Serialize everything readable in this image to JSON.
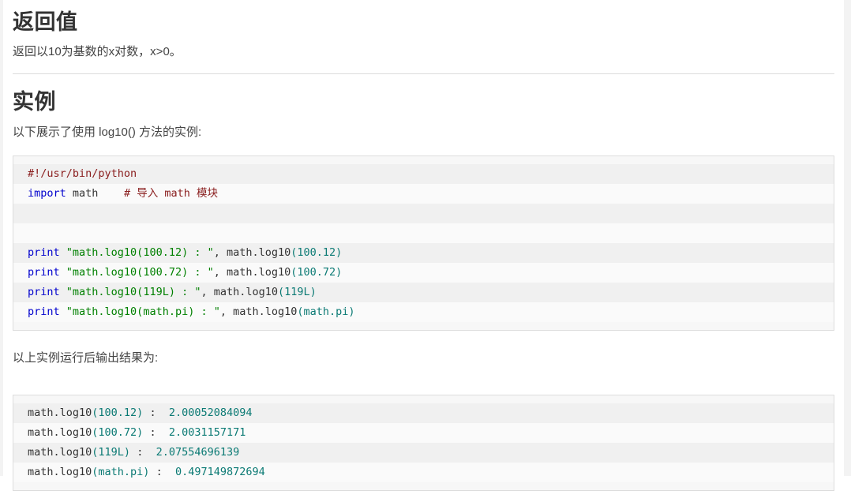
{
  "page": {
    "background_color": "#ffffff",
    "text_color": "#333333",
    "divider_color": "#dddddd"
  },
  "sections": {
    "return_value": {
      "heading": "返回值",
      "paragraph": "返回以10为基数的x对数，x>0。"
    },
    "example": {
      "heading": "实例",
      "intro_paragraph": "以下展示了使用 log10() 方法的实例:",
      "output_caption": "以上实例运行后输出结果为:"
    }
  },
  "code_block": {
    "language": "python",
    "lines": [
      [
        {
          "t": "#!/usr/bin/python",
          "c": "comment"
        }
      ],
      [
        {
          "t": "import",
          "c": "keyword"
        },
        {
          "t": " math    ",
          "c": "plain"
        },
        {
          "t": "# 导入 math 模块",
          "c": "comment"
        }
      ],
      [
        {
          "t": "",
          "c": "plain"
        }
      ],
      [
        {
          "t": "",
          "c": "plain"
        }
      ],
      [
        {
          "t": "print ",
          "c": "keyword"
        },
        {
          "t": "\"math.log10(100.12) : \"",
          "c": "string"
        },
        {
          "t": ", math.log10",
          "c": "plain"
        },
        {
          "t": "(100.12)",
          "c": "punct"
        }
      ],
      [
        {
          "t": "print ",
          "c": "keyword"
        },
        {
          "t": "\"math.log10(100.72) : \"",
          "c": "string"
        },
        {
          "t": ", math.log10",
          "c": "plain"
        },
        {
          "t": "(100.72)",
          "c": "punct"
        }
      ],
      [
        {
          "t": "print ",
          "c": "keyword"
        },
        {
          "t": "\"math.log10(119L) : \"",
          "c": "string"
        },
        {
          "t": ", math.log10",
          "c": "plain"
        },
        {
          "t": "(119L)",
          "c": "punct"
        }
      ],
      [
        {
          "t": "print ",
          "c": "keyword"
        },
        {
          "t": "\"math.log10(math.pi) : \"",
          "c": "string"
        },
        {
          "t": ", math.log10",
          "c": "plain"
        },
        {
          "t": "(math.pi)",
          "c": "punct"
        }
      ]
    ]
  },
  "output_block": {
    "lines": [
      [
        {
          "t": "math.log10",
          "c": "plain"
        },
        {
          "t": "(100.12)",
          "c": "punct"
        },
        {
          "t": " :  ",
          "c": "plain"
        },
        {
          "t": "2.00052084094",
          "c": "out-val"
        }
      ],
      [
        {
          "t": "math.log10",
          "c": "plain"
        },
        {
          "t": "(100.72)",
          "c": "punct"
        },
        {
          "t": " :  ",
          "c": "plain"
        },
        {
          "t": "2.0031157171",
          "c": "out-val"
        }
      ],
      [
        {
          "t": "math.log10",
          "c": "plain"
        },
        {
          "t": "(119L)",
          "c": "punct"
        },
        {
          "t": " :  ",
          "c": "plain"
        },
        {
          "t": "2.07554696139",
          "c": "out-val"
        }
      ],
      [
        {
          "t": "math.log10",
          "c": "plain"
        },
        {
          "t": "(math.pi)",
          "c": "punct"
        },
        {
          "t": " :  ",
          "c": "plain"
        },
        {
          "t": "0.497149872694",
          "c": "out-val"
        }
      ]
    ]
  },
  "syntax_colors": {
    "comment": "#8b2020",
    "keyword": "#0000cd",
    "string": "#008000",
    "plain": "#333333",
    "punct": "#0b7a74",
    "out_val": "#0b7a74",
    "stripe_a": "#f0f0f0",
    "stripe_b": "#fafafa"
  }
}
